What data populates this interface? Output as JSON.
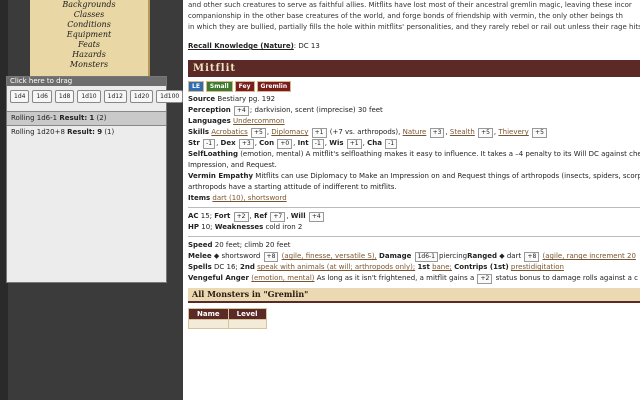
{
  "sidebar": {
    "nav": [
      "Backgrounds",
      "Classes",
      "Conditions",
      "Equipment",
      "Feats",
      "Hazards",
      "Monsters"
    ]
  },
  "dice_panel": {
    "drag_label": "Click here to drag",
    "buttons": [
      "1d4",
      "1d6",
      "1d8",
      "1d10",
      "1d12",
      "1d20",
      "1d100"
    ],
    "roll1": {
      "label": "Rolling 1d6-1",
      "result_label": "Result:",
      "result": "1",
      "detail": "(2)"
    },
    "roll2": {
      "label": "Rolling 1d20+8",
      "result_label": "Result:",
      "result": "9",
      "detail": "(1)"
    }
  },
  "intro": {
    "l1": "and other such creatures to serve as faithful allies. Mitflits have lost most of their ancestral gremlin magic, leaving these incor",
    "l2": "companionship in the other base creatures of the world, and forge bonds of friendship with vermin, the only other beings th",
    "l3": "in which they are bullied, partially fills the hole within mitflits' personalities, and they rarely rebel or rail out unless their rage hits",
    "recall_label": "Recall Knowledge (Nature)",
    "recall_value": ": DC 13"
  },
  "creature": {
    "name": "Mitflit",
    "traits": [
      {
        "label": "LE",
        "color": "#2f6db5"
      },
      {
        "label": "Small",
        "color": "#3d7a2f"
      },
      {
        "label": "Fey",
        "color": "#7a1d1d"
      },
      {
        "label": "Gremlin",
        "color": "#7a1d1d"
      }
    ],
    "source_label": "Source",
    "source_value": "Bestiary pg. 192",
    "perception_label": "Perception",
    "perception_mod": "+4",
    "perception_rest": "; darkvision, scent (imprecise) 30 feet",
    "languages_label": "Languages",
    "languages_value": "Undercommon",
    "skills_label": "Skills",
    "skills": [
      {
        "name": "Acrobatics",
        "mod": "+5"
      },
      {
        "name": "Diplomacy",
        "mod": "+1",
        "extra": "(+7 vs. arthropods)"
      },
      {
        "name": "Nature",
        "mod": "+3"
      },
      {
        "name": "Stealth",
        "mod": "+5"
      },
      {
        "name": "Thievery",
        "mod": "+5"
      }
    ],
    "abilities": [
      {
        "name": "Str",
        "mod": "-1"
      },
      {
        "name": "Dex",
        "mod": "+3"
      },
      {
        "name": "Con",
        "mod": "+0"
      },
      {
        "name": "Int",
        "mod": "-1"
      },
      {
        "name": "Wis",
        "mod": "+1"
      },
      {
        "name": "Cha",
        "mod": "-1"
      }
    ],
    "selfloathing_label": "SelfLoathing",
    "selfloathing_l1": "(emotion, mental) A mitflit's selfloathing makes it easy to influence. It takes a –4 penalty to its Will DC against che",
    "selfloathing_l2": "Impression, and Request.",
    "vermin_label": "Vermin Empathy",
    "vermin_l1": "Mitflits can use Diplomacy to Make an Impression on and Request things of arthropods (insects, spiders, scorp",
    "vermin_l2": "arthropods have a starting attitude of indifferent to mitflits.",
    "items_label": "Items",
    "items_value": "dart (10), shortsword",
    "ac_label": "AC",
    "ac_value": "15;",
    "fort_label": "Fort",
    "fort_mod": "+2",
    "ref_label": "Ref",
    "ref_mod": "+7",
    "will_label": "Will",
    "will_mod": "+4",
    "hp_label": "HP",
    "hp_value": "10;",
    "weak_label": "Weaknesses",
    "weak_value": "cold iron 2",
    "speed_label": "Speed",
    "speed_value": "20 feet; climb 20 feet",
    "melee_label": "Melee",
    "melee_weapon": "shortsword",
    "melee_mod": "+8",
    "melee_traits": "(agile, finesse, versatile S),",
    "damage_label": "Damage",
    "damage_value": "1d6-1",
    "damage_type": "piercing",
    "ranged_label": "Ranged",
    "ranged_weapon": "dart",
    "ranged_mod": "+8",
    "ranged_traits": "(agile, range increment 20",
    "spells_label": "Spells",
    "spells_value": "DC 16;",
    "spells_2nd": "2nd",
    "spells_2nd_value": "speak with animals (at will; arthropods only);",
    "spells_1st": "1st",
    "spells_1st_value": "bane;",
    "cantrips_label": "Contrips (1st)",
    "cantrips_value": "prestidigitation",
    "vengeful_label": "Vengeful Anger",
    "vengeful_traits": "(emotion, mental)",
    "vengeful_text": "As long as it isn't frightened, a mitflit gains a",
    "vengeful_mod": "+2",
    "vengeful_rest": "status bonus to damage rolls against a c"
  },
  "all_monsters": {
    "title": "All Monsters in \"Gremlin\"",
    "col_name": "Name",
    "col_level": "Level"
  }
}
